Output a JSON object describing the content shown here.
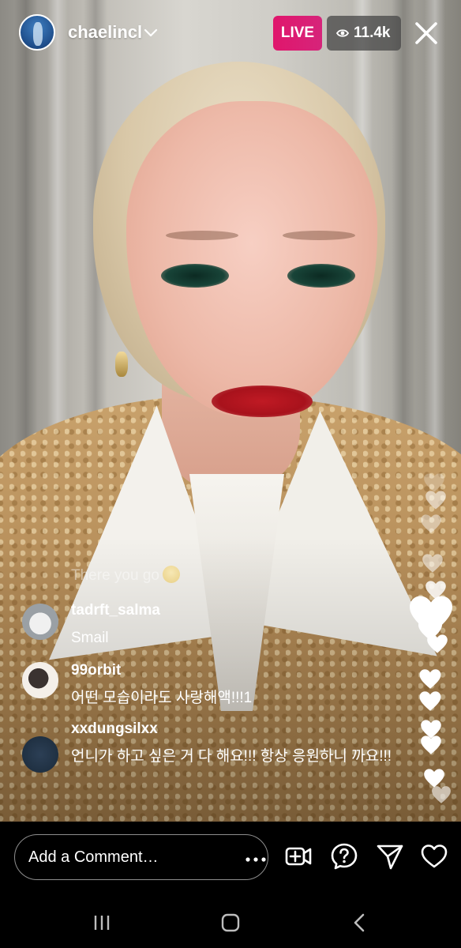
{
  "host": {
    "username": "chaelincl"
  },
  "live_badge": "LIVE",
  "viewer_count": "11.4k",
  "faded_comment": "There you go",
  "comments": [
    {
      "username": "tadrft_salma",
      "text": "Smail"
    },
    {
      "username": "99orbit",
      "text": "어떤 모습이라도 사랑해액!!!1"
    },
    {
      "username": "xxdungsilxx",
      "text": "언니가 하고 싶은 거 다 해요!!! 항상 응원하니 까요!!!"
    }
  ],
  "comment_box": {
    "placeholder": "Add a Comment…"
  },
  "icons": {
    "host_chevron": "chevron-down-icon",
    "viewer": "eye-icon",
    "close": "close-icon",
    "more": "more-dots-icon",
    "video_add": "add-video-icon",
    "question": "question-icon",
    "share": "paper-plane-icon",
    "like": "heart-icon",
    "nav_recents": "recents-icon",
    "nav_home": "home-icon",
    "nav_back": "back-icon"
  },
  "colors": {
    "live_badge": "#e0166c",
    "viewer_badge": "#464646",
    "text": "#ffffff",
    "background": "#000000"
  }
}
